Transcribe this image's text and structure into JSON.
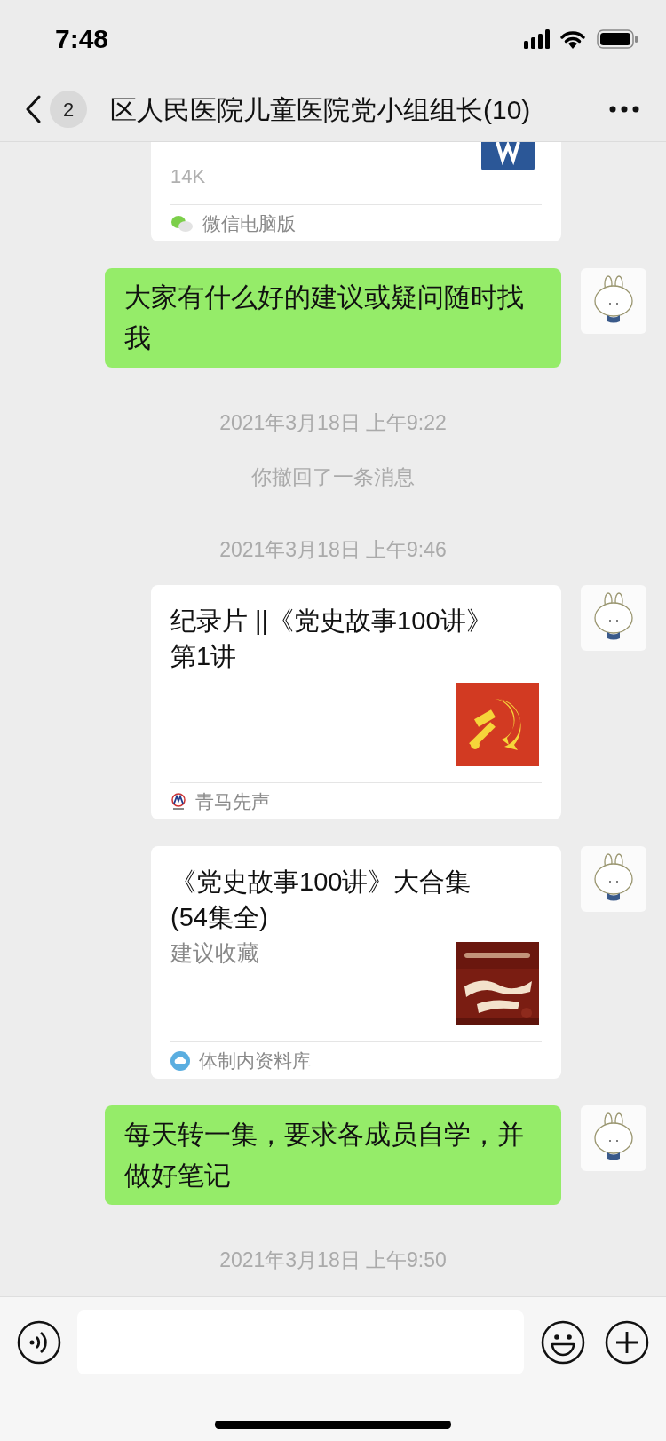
{
  "status_bar": {
    "time": "7:48"
  },
  "header": {
    "back_badge": "2",
    "title": "区人民医院儿童医院党小组组长(10)"
  },
  "messages": [
    {
      "kind": "file",
      "size": "14K",
      "source": "微信电脑版"
    },
    {
      "kind": "text",
      "text": "大家有什么好的建议或疑问随时找我"
    },
    {
      "kind": "time",
      "text": "2021年3月18日 上午9:22"
    },
    {
      "kind": "system",
      "text": "你撤回了一条消息"
    },
    {
      "kind": "time",
      "text": "2021年3月18日 上午9:46"
    },
    {
      "kind": "link",
      "title": "纪录片 ||《党史故事100讲》第1讲",
      "thumbnail": {
        "kind": "emblem"
      },
      "source_icon": {
        "kind": "badge"
      },
      "source": "青马先声"
    },
    {
      "kind": "link",
      "title": "《党史故事100讲》大合集 (54集全)",
      "description": "建议收藏",
      "source_icon": {
        "kind": "cloud"
      },
      "source": "体制内资料库"
    },
    {
      "kind": "text",
      "text": "每天转一集，要求各成员自学，并做好笔记"
    },
    {
      "kind": "time",
      "text": "2021年3月18日 上午9:50"
    }
  ]
}
